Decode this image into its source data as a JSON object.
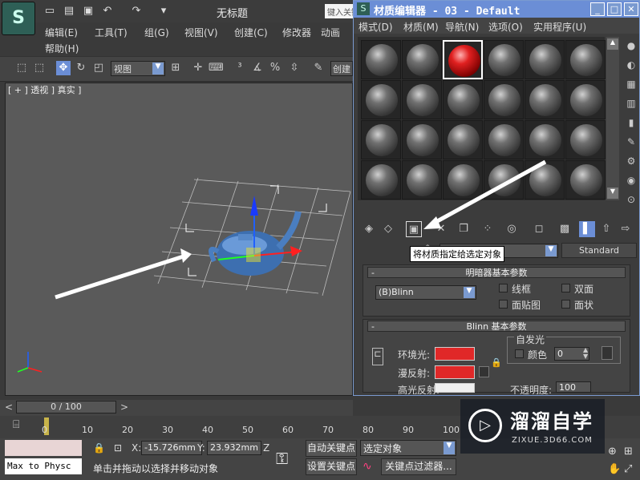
{
  "app": {
    "logo_glyph": "S",
    "title": "无标题",
    "search_placeholder": "键入关键字",
    "quick_access": [
      "new-icon",
      "open-icon",
      "save-icon",
      "undo-icon",
      "redo-icon",
      "dropdown-icon"
    ],
    "menu": [
      "编辑(E)",
      "工具(T)",
      "组(G)",
      "视图(V)",
      "创建(C)",
      "修改器",
      "动画",
      "帮助(H)"
    ]
  },
  "toolbar": {
    "view_select": "视图",
    "create_selection_set": "创建"
  },
  "viewport": {
    "label": "[ + ] 透视 ] 真实 ]"
  },
  "timeline": {
    "slider": "0 / 100",
    "ticks": [
      "0",
      "10",
      "20",
      "30",
      "40",
      "50",
      "60",
      "70",
      "80",
      "90",
      "100"
    ]
  },
  "status": {
    "maxscript": "Max to Physc",
    "prompt": "单击并拖动以选择并移动对象",
    "x_label": "X:",
    "x_value": "-15.726mm",
    "y_label": "Y:",
    "y_value": "23.932mm",
    "z_label": "Z",
    "auto_key": "自动关键点",
    "set_key": "设置关键点",
    "key_mode": "选定对象",
    "key_filters": "关键点过滤器..."
  },
  "material_editor": {
    "title": "材质编辑器 - 03 - Default",
    "menu": [
      "模式(D)",
      "材质(M)",
      "导航(N)",
      "选项(O)",
      "实用程序(U)"
    ],
    "active_slot": 2,
    "slot_count": 24,
    "tooltip": "将材质指定给选定对象",
    "standard_label": "Standard",
    "shader_rollout": {
      "title": "明暗器基本参数",
      "shader": "(B)Blinn",
      "options": [
        "线框",
        "双面",
        "面贴图",
        "面状"
      ]
    },
    "blinn_rollout": {
      "title": "Blinn 基本参数",
      "self_illum": "自发光",
      "color_label": "颜色",
      "color_value": "0",
      "ambient": "环境光:",
      "diffuse": "漫反射:",
      "specular": "高光反射:",
      "opacity": "不透明度:",
      "opacity_value": "100"
    }
  },
  "watermark": {
    "brand": "溜溜自学",
    "url": "ZIXUE.3D66.COM"
  },
  "colors": {
    "title_blue": "#6b8ed6",
    "material_red": "#e02828",
    "panel_bg": "#3c3c3c"
  }
}
